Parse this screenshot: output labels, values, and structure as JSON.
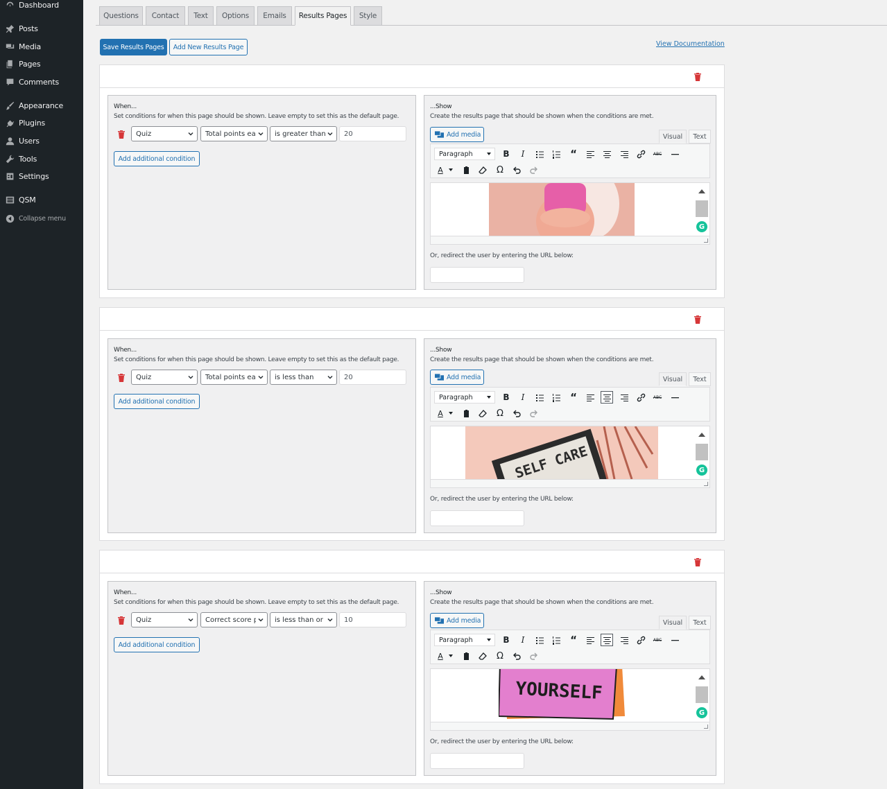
{
  "sidebar": {
    "items": [
      {
        "label": "Dashboard",
        "icon": "dashboard-icon"
      },
      {
        "label": "Posts",
        "icon": "pin-icon"
      },
      {
        "label": "Media",
        "icon": "media-icon"
      },
      {
        "label": "Pages",
        "icon": "pages-icon"
      },
      {
        "label": "Comments",
        "icon": "comment-icon"
      },
      {
        "label": "Appearance",
        "icon": "brush-icon"
      },
      {
        "label": "Plugins",
        "icon": "plug-icon"
      },
      {
        "label": "Users",
        "icon": "user-icon"
      },
      {
        "label": "Tools",
        "icon": "wrench-icon"
      },
      {
        "label": "Settings",
        "icon": "settings-icon"
      },
      {
        "label": "QSM",
        "icon": "list-icon"
      },
      {
        "label": "Collapse menu",
        "icon": "collapse-icon"
      }
    ]
  },
  "tabs": [
    {
      "label": "Questions"
    },
    {
      "label": "Contact"
    },
    {
      "label": "Text"
    },
    {
      "label": "Options"
    },
    {
      "label": "Emails"
    },
    {
      "label": "Results Pages",
      "active": true
    },
    {
      "label": "Style"
    }
  ],
  "toolbar": {
    "save_label": "Save Results Pages",
    "add_label": "Add New Results Page",
    "docs_label": "View Documentation"
  },
  "common": {
    "when_title": "When...",
    "when_desc": "Set conditions for when this page should be shown. Leave empty to set this as the default page.",
    "show_title": "...Show",
    "show_desc": "Create the results page that should be shown when the conditions are met.",
    "add_condition": "Add additional condition",
    "add_media": "Add media",
    "visual_tab": "Visual",
    "text_tab": "Text",
    "paragraph": "Paragraph",
    "redirect_label": "Or, redirect the user by entering the URL below:",
    "grammarly": "G"
  },
  "pages": [
    {
      "condition": {
        "scope": "Quiz",
        "metric": "Total points earned",
        "operator": "is greater than",
        "value": "20"
      },
      "image_colors": [
        "#eab2a4",
        "#e65fa8",
        "#f7e7e2"
      ],
      "image_text": ""
    },
    {
      "condition": {
        "scope": "Quiz",
        "metric": "Total points earned",
        "operator": "is less than",
        "value": "20"
      },
      "image_colors": [
        "#f4c9bb",
        "#2b2b2b",
        "#e8e4dd"
      ],
      "image_text": "SELF CARE"
    },
    {
      "condition": {
        "scope": "Quiz",
        "metric": "Correct score percentage",
        "operator": "is less than or equal to",
        "value": "10"
      },
      "image_colors": [
        "#e37fce",
        "#f08a3a",
        "#1d1d1d"
      ],
      "image_text": "YOURSELF"
    }
  ],
  "colors": {
    "accent": "#2271b1",
    "delete": "#d63638",
    "sidebar_bg": "#1d2327"
  }
}
